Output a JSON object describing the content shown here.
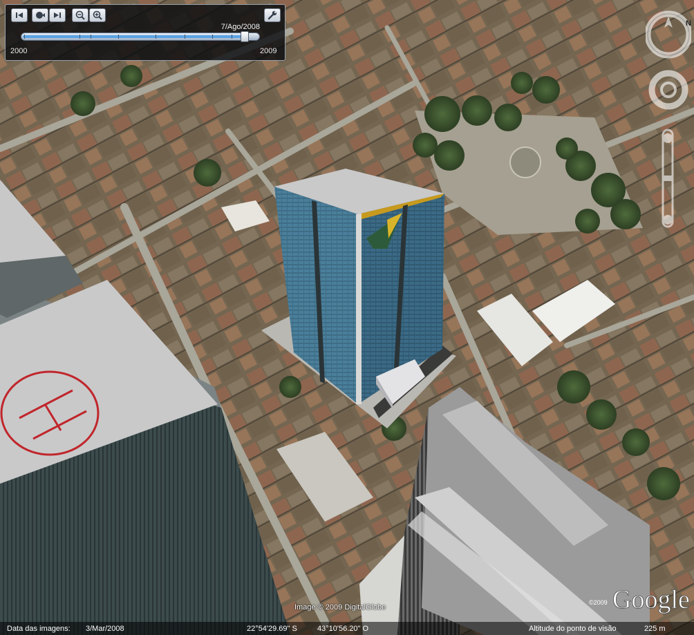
{
  "time_slider": {
    "current_date": "7/Ago/2008",
    "start_year": "2000",
    "end_year": "2009",
    "position": 0.94,
    "buttons": [
      {
        "name": "previous-icon"
      },
      {
        "name": "clock-icon"
      },
      {
        "name": "next-icon"
      },
      {
        "name": "zoom-out-icon"
      },
      {
        "name": "zoom-in-icon"
      }
    ],
    "settings_icon": "wrench-icon"
  },
  "navigation": {
    "compass_letter": "N"
  },
  "imagery": {
    "copyright": "Image © 2009 DigitalGlobe",
    "logo_text": "Google",
    "logo_year": "©2009"
  },
  "status_bar": {
    "imagery_date_label": "Data das imagens:",
    "imagery_date": "3/Mar/2008",
    "latitude": "22°54'29.69\" S",
    "longitude": "43°10'56.20\" O",
    "altitude_label": "Altitude do ponto de visão",
    "altitude": "225 m"
  },
  "colors": {
    "tower_glass": "#3f6d86",
    "helipad_marking": "#c0262c",
    "logo_accent": "#2d5a3a"
  }
}
